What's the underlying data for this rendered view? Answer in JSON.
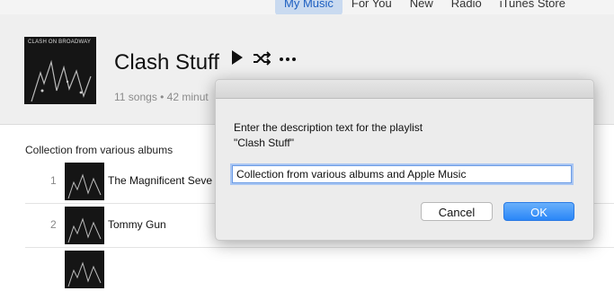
{
  "nav": {
    "tabs": [
      "My Music",
      "For You",
      "New",
      "Radio",
      "iTunes Store"
    ],
    "active_index": 0
  },
  "playlist": {
    "title": "Clash Stuff",
    "meta": "11 songs • 42 minut",
    "description": "Collection from various albums",
    "cover_caption": "CLASH ON BROADWAY"
  },
  "controls": {
    "play_icon": "play-icon",
    "shuffle_icon": "shuffle-icon",
    "more_icon": "more-icon"
  },
  "tracks": [
    {
      "number": "1",
      "title": "The Magnificent Seve"
    },
    {
      "number": "2",
      "title": "Tommy Gun"
    },
    {
      "number": "",
      "title": ""
    }
  ],
  "dialog": {
    "prompt_line1": "Enter the description text for the playlist",
    "prompt_line2": "\"Clash Stuff\"",
    "input_value": "Collection from various albums and Apple Music",
    "cancel_label": "Cancel",
    "ok_label": "OK"
  },
  "colors": {
    "accent": "#2a86f7",
    "nav_active_bg": "#c9daf0"
  }
}
